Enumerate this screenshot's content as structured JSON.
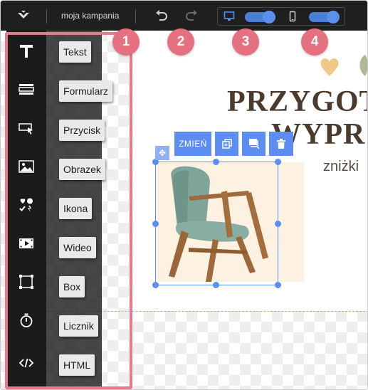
{
  "topbar": {
    "campaign_name": "moja kampania"
  },
  "sidebar": {
    "items": [
      {
        "label": "Tekst",
        "icon": "text-icon"
      },
      {
        "label": "Formularz",
        "icon": "form-icon"
      },
      {
        "label": "Przycisk",
        "icon": "button-icon"
      },
      {
        "label": "Obrazek",
        "icon": "image-icon"
      },
      {
        "label": "Ikona",
        "icon": "icons-icon"
      },
      {
        "label": "Wideo",
        "icon": "video-icon"
      },
      {
        "label": "Box",
        "icon": "box-icon"
      },
      {
        "label": "Licznik",
        "icon": "timer-icon"
      },
      {
        "label": "HTML",
        "icon": "code-icon"
      }
    ]
  },
  "badges": [
    "1",
    "2",
    "3",
    "4"
  ],
  "content": {
    "headline_line1": "PRZYGOT",
    "headline_line2": "WYPR",
    "subline": "zniżki"
  },
  "element_toolbar": {
    "change_label": "ZMIEŃ",
    "icons": [
      "duplicate-icon",
      "layer-icon",
      "trash-icon"
    ]
  },
  "colors": {
    "accent": "#5b8ef0",
    "badge": "#e5707f",
    "highlight": "#e57b8c",
    "headline": "#4b3a2e",
    "topbar": "#1f1f1f"
  }
}
